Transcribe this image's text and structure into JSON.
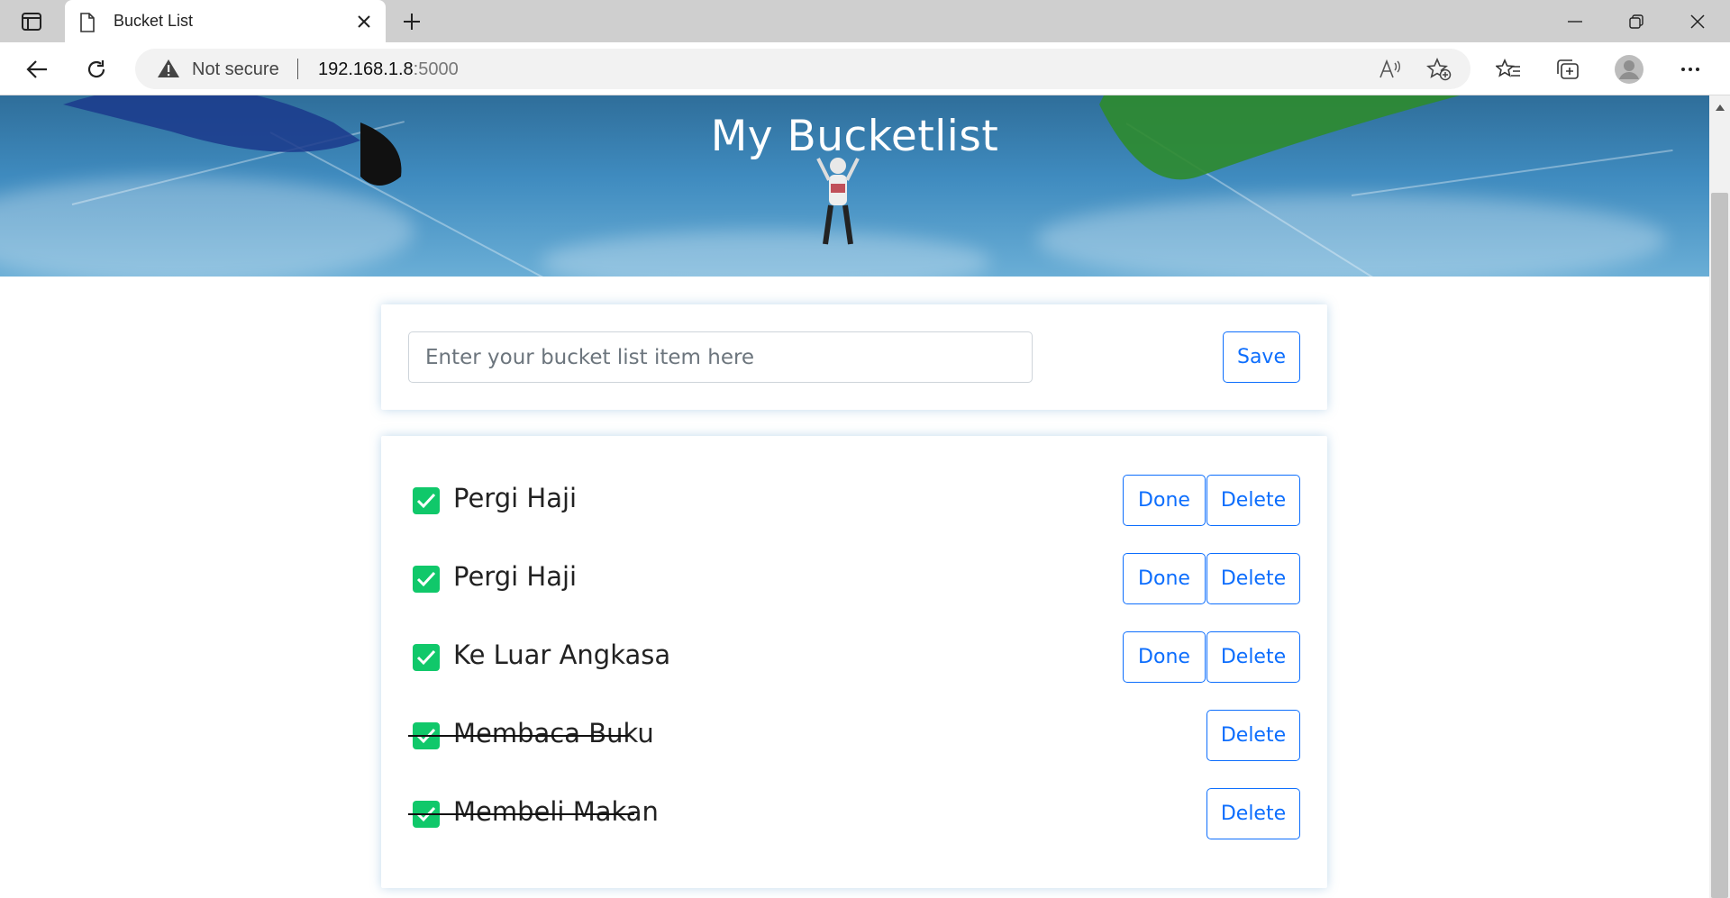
{
  "browser": {
    "tab_title": "Bucket List",
    "address_warning": "Not secure",
    "url_host": "192.168.1.8",
    "url_port": ":5000"
  },
  "page": {
    "title": "My Bucketlist",
    "input_placeholder": "Enter your bucket list item here",
    "save_label": "Save",
    "done_label": "Done",
    "delete_label": "Delete",
    "items": [
      {
        "text": "Pergi Haji",
        "done": false
      },
      {
        "text": "Pergi Haji",
        "done": false
      },
      {
        "text": "Ke Luar Angkasa",
        "done": false
      },
      {
        "text": "Membaca Buku",
        "done": true
      },
      {
        "text": "Membeli Makan",
        "done": true
      }
    ]
  },
  "colors": {
    "accent": "#0d6efd",
    "check": "#10c86a"
  }
}
